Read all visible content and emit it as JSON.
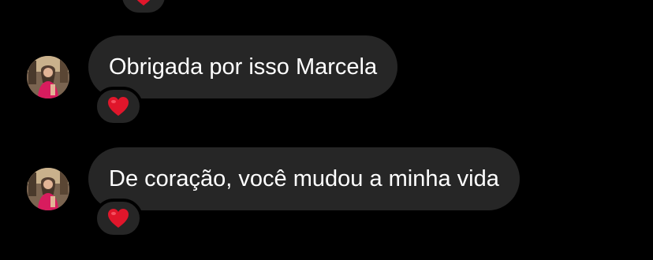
{
  "thread": {
    "messages": [
      {
        "text": "Obrigada por isso Marcela",
        "reaction": "heart-icon"
      },
      {
        "text": "De coração, você mudou a minha vida",
        "reaction": "heart-icon"
      }
    ]
  },
  "colors": {
    "background": "#000000",
    "bubble": "#262626",
    "text": "#ffffff",
    "heart": "#e0162b"
  }
}
